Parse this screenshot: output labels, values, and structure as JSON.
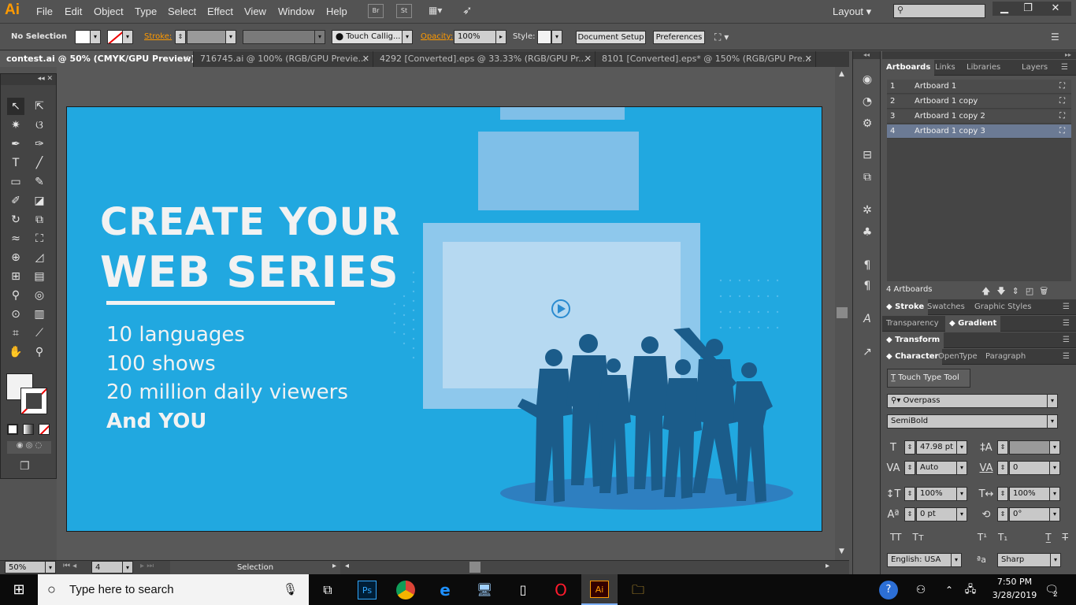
{
  "app": {
    "logo": "Ai",
    "menu": [
      "File",
      "Edit",
      "Object",
      "Type",
      "Select",
      "Effect",
      "View",
      "Window",
      "Help"
    ],
    "bridge_btn": "Br",
    "stock_btn": "St",
    "workspace": "Layout"
  },
  "control": {
    "selection": "No Selection",
    "stroke_label": "Stroke:",
    "brush": "Touch Callig...",
    "opacity_label": "Opacity:",
    "opacity": "100%",
    "style_label": "Style:",
    "doc_setup": "Document Setup",
    "preferences": "Preferences"
  },
  "tabs": [
    {
      "label": "contest.ai @ 50% (CMYK/GPU Preview)"
    },
    {
      "label": "716745.ai @ 100% (RGB/GPU Previe..."
    },
    {
      "label": "4292 [Converted].eps @ 33.33% (RGB/GPU Pr..."
    },
    {
      "label": "8101 [Converted].eps* @ 150% (RGB/GPU Pre..."
    }
  ],
  "art": {
    "headline1": "CREATE YOUR",
    "headline2": "WEB SERIES",
    "line1": "10 languages",
    "line2": "100 shows",
    "line3": "20 million daily viewers",
    "line4": "And YOU"
  },
  "status": {
    "zoom": "50%",
    "artboard": "4",
    "tool": "Selection"
  },
  "artboards_panel": {
    "tabs": [
      "Artboards",
      "Links",
      "Libraries",
      "Layers"
    ],
    "rows": [
      {
        "num": "1",
        "name": "Artboard 1"
      },
      {
        "num": "2",
        "name": "Artboard 1 copy"
      },
      {
        "num": "3",
        "name": "Artboard 1 copy 2"
      },
      {
        "num": "4",
        "name": "Artboard 1 copy 3"
      }
    ],
    "count": "4 Artboards"
  },
  "stroke_tabs": [
    "Stroke",
    "Swatches",
    "Graphic Styles"
  ],
  "transp_tabs": [
    "Transparency",
    "Gradient"
  ],
  "transform_tab": "Transform",
  "char_tabs": [
    "Character",
    "OpenType",
    "Paragraph"
  ],
  "character": {
    "touch_type": "Touch Type Tool",
    "font": "Overpass",
    "style": "SemiBold",
    "size": "47.98 pt",
    "leading": "",
    "kerning": "Auto",
    "tracking": "0",
    "vscale": "100%",
    "hscale": "100%",
    "baseline": "0 pt",
    "rotation": "0°",
    "language": "English: USA",
    "aa": "Sharp"
  },
  "taskbar": {
    "search": "Type here to search",
    "time": "7:50 PM",
    "date": "3/28/2019",
    "notif": "2"
  },
  "colors": {
    "artboard": "#21a8e0",
    "silhouette": "#1b5c8a",
    "panel_light": "#7fbfe8",
    "accent": "#ff9a00"
  }
}
